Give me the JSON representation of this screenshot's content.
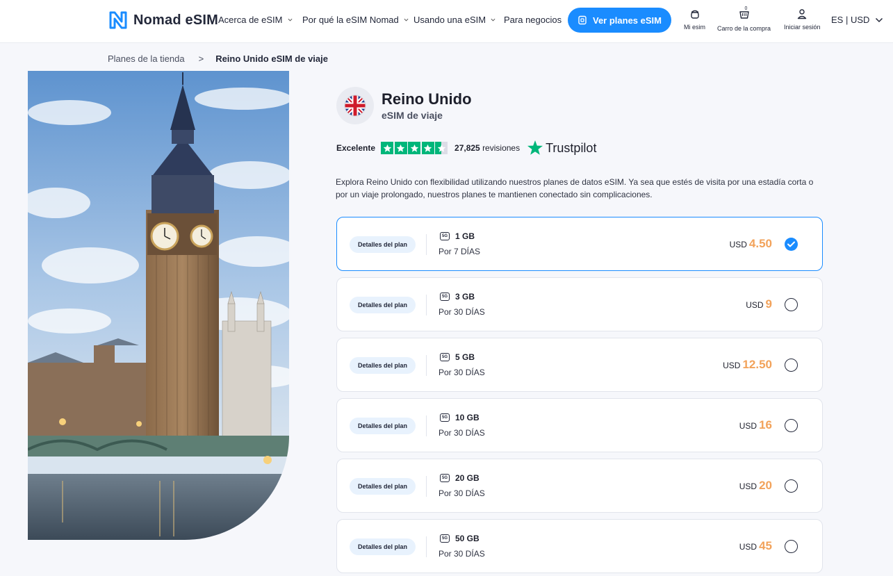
{
  "header": {
    "brand": "Nomad eSIM",
    "nav": [
      {
        "label": "Acerca de eSIM",
        "dropdown": true
      },
      {
        "label": "Por qué la eSIM Nomad",
        "dropdown": true
      },
      {
        "label": "Usando una eSIM",
        "dropdown": true
      },
      {
        "label": "Para negocios",
        "dropdown": false
      }
    ],
    "cta_label": "Ver planes eSIM",
    "icons": {
      "my_esim": "Mi esim",
      "cart": "Carro de la compra",
      "cart_count": "0",
      "login": "Iniciar sesión"
    },
    "lang": "ES | USD"
  },
  "breadcrumb": {
    "parent": "Planes de la tienda",
    "separator": ">",
    "current": "Reino Unido eSIM de viaje"
  },
  "product": {
    "country": "Reino Unido",
    "subtitle": "eSIM de viaje",
    "rating_word": "Excelente",
    "stars": 4.5,
    "reviews_count": "27,825",
    "reviews_label": "revisiones",
    "trustpilot": "Trustpilot",
    "description": "Explora Reino Unido con flexibilidad utilizando nuestros planes de datos eSIM. Ya sea que estés de visita por una estadía corta o por un viaje prolongado, nuestros planes te mantienen conectado sin complicaciones."
  },
  "plans": [
    {
      "detail_label": "Detalles del plan",
      "network": "5G",
      "data": "1 GB",
      "duration": "Por 7 DÍAS",
      "currency": "USD",
      "price": "4.50",
      "selected": true
    },
    {
      "detail_label": "Detalles del plan",
      "network": "5G",
      "data": "3 GB",
      "duration": "Por 30 DÍAS",
      "currency": "USD",
      "price": "9",
      "selected": false
    },
    {
      "detail_label": "Detalles del plan",
      "network": "5G",
      "data": "5 GB",
      "duration": "Por 30 DÍAS",
      "currency": "USD",
      "price": "12.50",
      "selected": false
    },
    {
      "detail_label": "Detalles del plan",
      "network": "5G",
      "data": "10 GB",
      "duration": "Por 30 DÍAS",
      "currency": "USD",
      "price": "16",
      "selected": false
    },
    {
      "detail_label": "Detalles del plan",
      "network": "5G",
      "data": "20 GB",
      "duration": "Por 30 DÍAS",
      "currency": "USD",
      "price": "20",
      "selected": false
    },
    {
      "detail_label": "Detalles del plan",
      "network": "5G",
      "data": "50 GB",
      "duration": "Por 30 DÍAS",
      "currency": "USD",
      "price": "45",
      "selected": false
    }
  ],
  "colors": {
    "accent": "#1a8cff",
    "price": "#f2a25a",
    "trustpilot_green": "#00b67a"
  }
}
